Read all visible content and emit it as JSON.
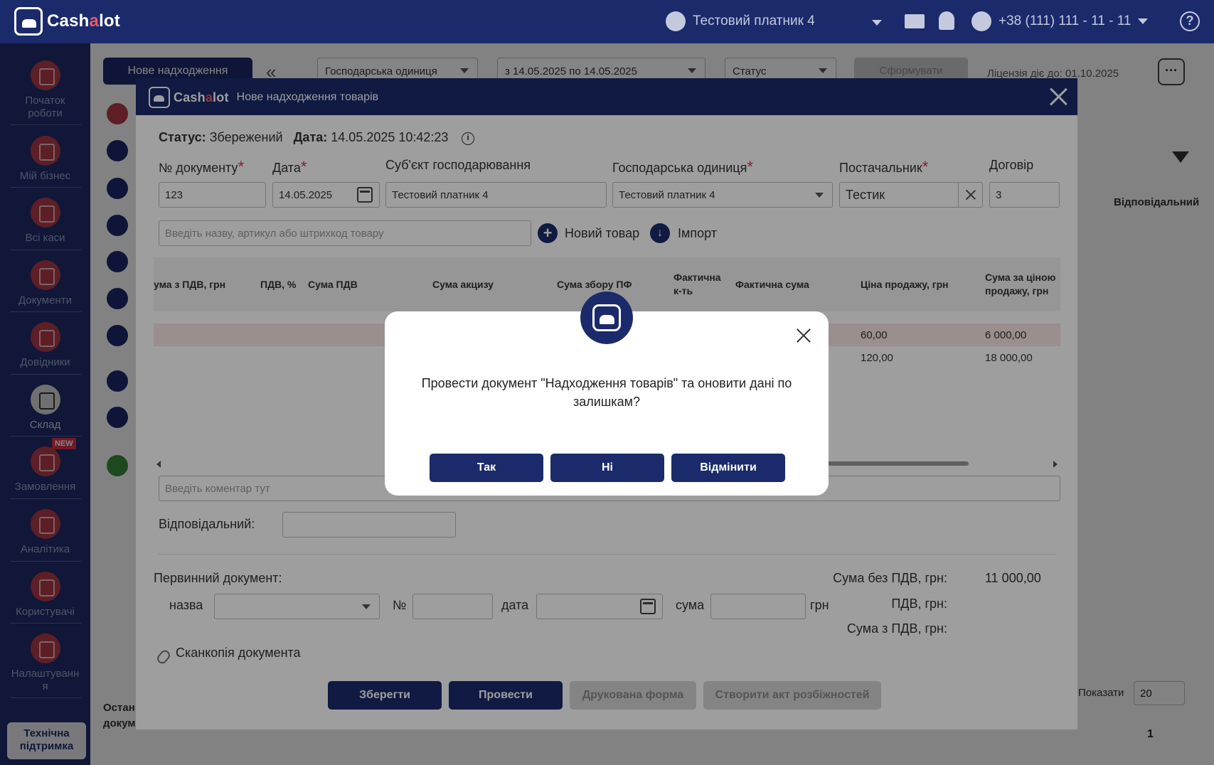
{
  "app": {
    "brand_prefix": "Cash",
    "brand_accent": "a",
    "brand_suffix": "lot",
    "accent_color": "#1b2a6b",
    "brand_color": "#e85a6a"
  },
  "topbar": {
    "business": "Тестовий платник 4",
    "phone": "+38 (111) 111 - 11 - 11",
    "help": "?"
  },
  "sidebar": {
    "items": [
      {
        "label": "Початок роботи",
        "icon": "start-icon"
      },
      {
        "label": "Мій бізнес",
        "icon": "home-icon"
      },
      {
        "label": "Всі каси",
        "icon": "cash-register-icon"
      },
      {
        "label": "Документи",
        "icon": "documents-icon"
      },
      {
        "label": "Довідники",
        "icon": "directory-icon"
      },
      {
        "label": "Склад",
        "icon": "warehouse-icon"
      },
      {
        "label": "Замовлення",
        "icon": "orders-icon",
        "badge": "NEW"
      },
      {
        "label": "Аналітика",
        "icon": "analytics-icon"
      },
      {
        "label": "Користувачі",
        "icon": "users-icon"
      },
      {
        "label": "Налаштування",
        "icon": "settings-icon"
      }
    ],
    "support": "Технічна підтримка"
  },
  "background": {
    "new_button": "Нове надходження",
    "filter_unit": "Господарська одиниця",
    "filter_date": "з 14.05.2025 по 14.05.2025",
    "filter_status": "Статус",
    "form_button": "Сформувати",
    "license": "Ліцензія діє до: 01.10.2025",
    "col_responsible": "Відповідальний",
    "show_label": "Показати",
    "per_page": "20",
    "page": "1",
    "last_docs": "Остан\nдокум"
  },
  "modal": {
    "title": "Нове надходження товарів",
    "status_label": "Статус:",
    "status_value": "Збережений",
    "date_label": "Дата:",
    "date_value": "14.05.2025 10:42:23",
    "fields": {
      "doc_no_label": "№ документу",
      "doc_no": "123",
      "date_label": "Дата",
      "date": "14.05.2025",
      "entity_label": "Суб'єкт господарювання",
      "entity": "Тестовий платник 4",
      "unit_label": "Господарська одиниця",
      "unit": "Тестовий платник 4",
      "supplier_label": "Постачальник",
      "supplier": "Тестик",
      "contract_label": "Договір",
      "contract": "3",
      "search_placeholder": "Введіть назву, артикул або штрихкод товару"
    },
    "new_product": "Новий товар",
    "import": "Імпорт",
    "columns": [
      "ума з ПДВ, грн",
      "ПДВ, %",
      "Сума ПДВ",
      "Сума акцизу",
      "Сума збору ПФ",
      "Фактична к-ть",
      "Фактична сума",
      "Ціна продажу, грн",
      "Сума за ціною продажу, грн"
    ],
    "rows": [
      {
        "price": "60,00",
        "sum": "6 000,00"
      },
      {
        "price": "120,00",
        "sum": "18 000,00"
      }
    ],
    "comment_placeholder": "Введіть коментар тут",
    "responsible_label": "Відповідальний:",
    "primary_doc_label": "Первинний документ:",
    "primary_name": "назва",
    "primary_no": "№",
    "primary_date": "дата",
    "primary_sum": "сума",
    "primary_currency": "грн",
    "totals": {
      "no_vat_label": "Сума без ПДВ, грн:",
      "no_vat": "11 000,00",
      "vat_label": "ПДВ, грн:",
      "with_vat_label": "Сума з ПДВ, грн:"
    },
    "scan_copy": "Сканкопія документа",
    "buttons": {
      "save": "Зберегти",
      "post": "Провести",
      "print": "Друкована форма",
      "discrepancy": "Створити акт розбіжностей"
    }
  },
  "dialog": {
    "message": "Провести документ \"Надходження товарів\" та оновити дані по залишкам?",
    "yes": "Так",
    "no": "Ні",
    "cancel": "Відмінити"
  }
}
